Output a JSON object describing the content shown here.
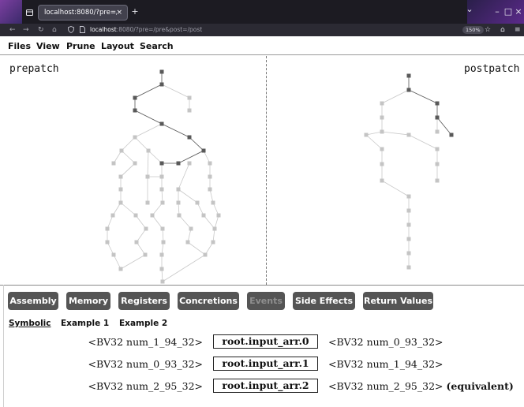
{
  "browser": {
    "tab_title": "localhost:8080/?pre=/pre",
    "tab_close": "×",
    "new_tab": "+",
    "url_host": "localhost",
    "url_path": ":8080/?pre=/pre&post=/post",
    "zoom": "150%",
    "window_controls": {
      "chevron": "⌄",
      "minimize": "–",
      "maximize": "□",
      "close": "×"
    }
  },
  "menu": [
    "Files",
    "View",
    "Prune",
    "Layout",
    "Search"
  ],
  "graph": {
    "left_label": "prepatch",
    "right_label": "postpatch"
  },
  "buttons": [
    {
      "label": "Assembly",
      "enabled": true
    },
    {
      "label": "Memory",
      "enabled": true
    },
    {
      "label": "Registers",
      "enabled": true
    },
    {
      "label": "Concretions",
      "enabled": true
    },
    {
      "label": "Events",
      "enabled": false
    },
    {
      "label": "Side Effects",
      "enabled": true
    },
    {
      "label": "Return Values",
      "enabled": true
    }
  ],
  "subtabs": [
    {
      "label": "Symbolic",
      "active": true
    },
    {
      "label": "Example 1",
      "active": false
    },
    {
      "label": "Example 2",
      "active": false
    }
  ],
  "rows": [
    {
      "pre": "<BV32 num_1_94_32>",
      "name": "root.input_arr.0",
      "post": "<BV32 num_0_93_32>",
      "note": ""
    },
    {
      "pre": "<BV32 num_0_93_32>",
      "name": "root.input_arr.1",
      "post": "<BV32 num_1_94_32>",
      "note": ""
    },
    {
      "pre": "<BV32 num_2_95_32>",
      "name": "root.input_arr.2",
      "post": "<BV32 num_2_95_32>",
      "note": "(equivalent)"
    }
  ]
}
